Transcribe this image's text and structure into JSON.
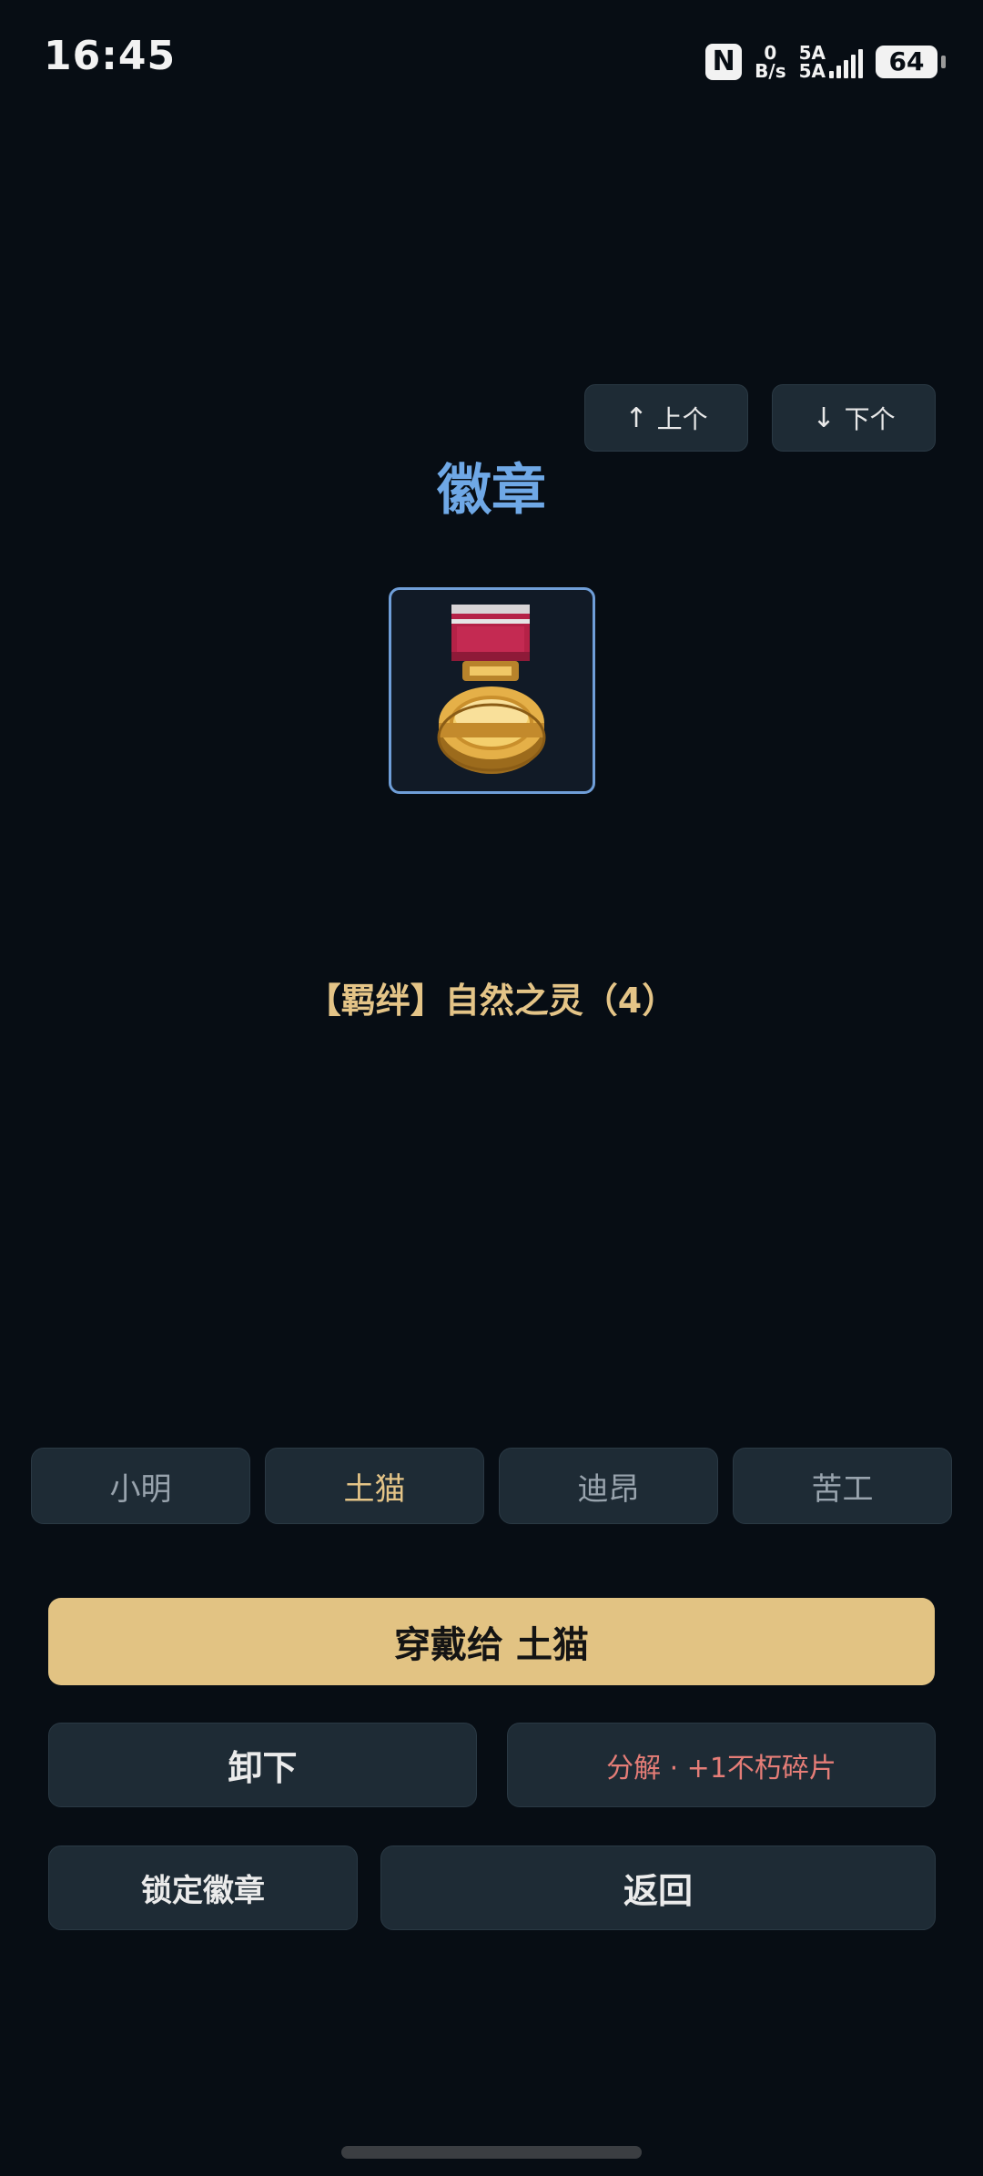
{
  "status_bar": {
    "time": "16:45",
    "nfc_icon": "N",
    "net_speed_value": "0",
    "net_speed_unit": "B/s",
    "sim1": "5A",
    "sim2": "5A",
    "battery": "64"
  },
  "nav": {
    "prev_label": "上个",
    "prev_arrow": "↑",
    "next_label": "下个",
    "next_arrow": "↓"
  },
  "title": "徽章",
  "badge": {
    "icon": "gold-medal-icon"
  },
  "bond_text": "【羁绊】自然之灵（4）",
  "characters": {
    "items": [
      {
        "label": "小明"
      },
      {
        "label": "土猫"
      },
      {
        "label": "迪昂"
      },
      {
        "label": "苦工"
      }
    ],
    "selected_index": 1
  },
  "actions": {
    "equip_label": "穿戴给 土猫",
    "unequip_label": "卸下",
    "decompose_label": "分解 · +1不朽碎片",
    "lock_label": "锁定徽章",
    "back_label": "返回"
  },
  "colors": {
    "background": "#070d14",
    "title": "#6fa8e6",
    "gold": "#e4c487",
    "equip_button": "#e2c383",
    "button_dark": "#1e2b35",
    "decompose_text": "#e57d77"
  }
}
